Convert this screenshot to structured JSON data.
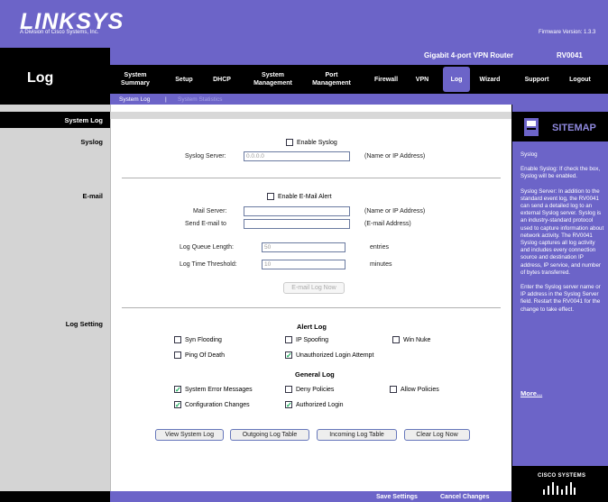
{
  "brand": {
    "logo": "LINKSYS",
    "tagline": "A Division of Cisco Systems, Inc.",
    "firmware": "Firmware Version: 1.3.3",
    "router_name": "Gigabit 4-port VPN Router",
    "router_model": "RV0041"
  },
  "section_title": "Log",
  "nav": {
    "items": [
      {
        "label": "System Summary"
      },
      {
        "label": "Setup"
      },
      {
        "label": "DHCP"
      },
      {
        "label": "System Management"
      },
      {
        "label": "Port Management"
      },
      {
        "label": "Firewall"
      },
      {
        "label": "VPN"
      },
      {
        "label": "Log"
      },
      {
        "label": "Wizard"
      },
      {
        "label": "Support"
      },
      {
        "label": "Logout"
      }
    ],
    "active": "Log",
    "subnav": [
      {
        "label": "System Log"
      },
      {
        "label": "System Statistics"
      }
    ],
    "subnav_separator": "|"
  },
  "left_labels": {
    "system_log": "System Log",
    "syslog": "Syslog",
    "email": "E-mail",
    "log_setting": "Log Setting"
  },
  "syslog": {
    "enable_label": "Enable Syslog",
    "enable_checked": false,
    "server_label": "Syslog Server:",
    "server_value": "0.0.0.0",
    "server_hint": "(Name or IP Address)"
  },
  "email": {
    "enable_label": "Enable E-Mail Alert",
    "enable_checked": false,
    "mail_server_label": "Mail Server:",
    "mail_server_value": "",
    "mail_server_hint": "(Name or IP Address)",
    "send_to_label": "Send E-mail to",
    "send_to_value": "",
    "send_to_hint": "(E-mail Address)",
    "queue_label": "Log Queue Length:",
    "queue_value": "50",
    "queue_unit": "entries",
    "threshold_label": "Log Time Threshold:",
    "threshold_value": "10",
    "threshold_unit": "minutes",
    "email_now_button": "E-mail Log Now"
  },
  "log_setting": {
    "alert_log_heading": "Alert Log",
    "alert": [
      {
        "label": "Syn Flooding",
        "checked": false
      },
      {
        "label": "IP Spoofing",
        "checked": false
      },
      {
        "label": "Win Nuke",
        "checked": false
      },
      {
        "label": "Ping Of Death",
        "checked": false
      },
      {
        "label": "Unauthorized Login Attempt",
        "checked": true
      }
    ],
    "general_log_heading": "General Log",
    "general": [
      {
        "label": "System Error Messages",
        "checked": true
      },
      {
        "label": "Deny Policies",
        "checked": false
      },
      {
        "label": "Allow Policies",
        "checked": false
      },
      {
        "label": "Configuration Changes",
        "checked": true
      },
      {
        "label": "Authorized Login",
        "checked": true
      }
    ]
  },
  "buttons": {
    "view_system_log": "View System Log",
    "outgoing_log_table": "Outgoing Log Table",
    "incoming_log_table": "Incoming Log Table",
    "clear_log_now": "Clear Log Now",
    "save_settings": "Save Settings",
    "cancel_changes": "Cancel Changes"
  },
  "sitemap": {
    "label": "SITEMAP",
    "help": [
      "Syslog",
      "Enable Syslog: If check the box, Syslog will be enabled.",
      "Syslog Server: In addition to the standard event log, the RV0041 can send a detailed log to an external Syslog server. Syslog is an industry-standard protocol used to capture information about network activity. The RV0041 Syslog captures all log activity and includes every connection source and destination IP address, IP service, and number of bytes transferred.",
      "Enter the Syslog server name or IP address in the Syslog Server field. Restart the RV0041 for the change to take effect."
    ],
    "more": "More..."
  },
  "cisco": "CISCO SYSTEMS",
  "colors": {
    "brand_purple": "#6c64c8",
    "panel_gray": "#d4d4d4",
    "black": "#000000"
  }
}
